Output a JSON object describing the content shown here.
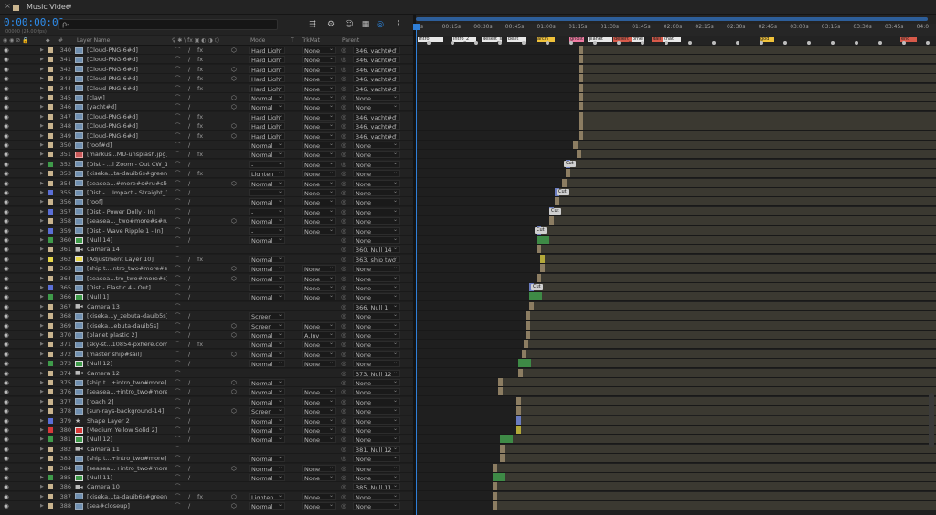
{
  "window": {
    "close_glyph": "×",
    "title": "Music Video",
    "menu_glyph": "≡"
  },
  "toolbar": {
    "timecode": "0:00:00:00",
    "frames": "00000 (24.00 fps)",
    "search_glyph": "ρ-",
    "icons": [
      "comp-flowchart-icon",
      "draft-3d-icon",
      "shy-layers-icon",
      "frame-blending-icon",
      "motion-blur-icon",
      "graph-editor-icon"
    ]
  },
  "columns": {
    "source_icons": "◉ ◉ ⊘ 🔒",
    "label_icon": "◆",
    "num": "#",
    "layer_name": "Layer Name",
    "switches": "♀ ✱ \\ fx ▣ ◐ ◑ ⬡",
    "mode": "Mode",
    "t": "T",
    "trkmat": "TrkMat",
    "parent": "Parent"
  },
  "ruler": {
    "ticks": [
      "0s",
      "00:15s",
      "00:30s",
      "00:45s",
      "01:00s",
      "01:15s",
      "01:30s",
      "01:45s",
      "02:00s",
      "02:15s",
      "02:30s",
      "02:45s",
      "03:00s",
      "03:15s",
      "03:30s",
      "03:45s",
      "04:0"
    ]
  },
  "markers": [
    {
      "text": "Intro",
      "color": "#e8e8e8"
    },
    {
      "text": "intro_2",
      "color": "#e8e8e8"
    },
    {
      "text": "desert_sh",
      "color": "#e8e8e8"
    },
    {
      "text": "beat",
      "color": "#e8e8e8"
    },
    {
      "text": "arch",
      "color": "#f0c23a"
    },
    {
      "text": "ghost",
      "color": "#f07aa2"
    },
    {
      "text": "planet",
      "color": "#e8e8e8"
    },
    {
      "text": "desert_ti",
      "color": "#d85a4a"
    },
    {
      "text": "ome",
      "color": "#e8e8e8"
    },
    {
      "text": "dail",
      "color": "#d85a4a"
    },
    {
      "text": "chat",
      "color": "#e8e8e8"
    },
    {
      "text": "god",
      "color": "#f0c23a"
    },
    {
      "text": "end",
      "color": "#d85a4a"
    }
  ],
  "layers": [
    {
      "num": "340",
      "name": "[Cloud-PNG-6#d]",
      "label": "#c9b48e",
      "type": "footage",
      "fx": true,
      "mode": "Hard Ligh",
      "trkmat": "None",
      "parent": "346. yacht#d"
    },
    {
      "num": "341",
      "name": "[Cloud-PNG-6#d]",
      "label": "#c9b48e",
      "type": "footage",
      "fx": true,
      "mode": "Hard Ligh",
      "trkmat": "None",
      "parent": "346. yacht#d"
    },
    {
      "num": "342",
      "name": "[Cloud-PNG-6#d]",
      "label": "#c9b48e",
      "type": "footage",
      "fx": true,
      "mode": "Hard Ligh",
      "trkmat": "None",
      "parent": "346. yacht#d"
    },
    {
      "num": "343",
      "name": "[Cloud-PNG-6#d]",
      "label": "#c9b48e",
      "type": "footage",
      "fx": true,
      "mode": "Hard Ligh",
      "trkmat": "None",
      "parent": "346. yacht#d"
    },
    {
      "num": "344",
      "name": "[Cloud-PNG-6#d]",
      "label": "#c9b48e",
      "type": "footage",
      "fx": true,
      "mode": "Hard Ligh",
      "trkmat": "None",
      "parent": "346. yacht#d"
    },
    {
      "num": "345",
      "name": "[claw]",
      "label": "#c9b48e",
      "type": "footage",
      "fx": false,
      "mode": "Normal",
      "trkmat": "None",
      "parent": "None"
    },
    {
      "num": "346",
      "name": "[yacht#d]",
      "label": "#c9b48e",
      "type": "footage",
      "fx": false,
      "mode": "Normal",
      "trkmat": "None",
      "parent": "None"
    },
    {
      "num": "347",
      "name": "[Cloud-PNG-6#d]",
      "label": "#c9b48e",
      "type": "footage",
      "fx": true,
      "mode": "Hard Ligh",
      "trkmat": "None",
      "parent": "346. yacht#d"
    },
    {
      "num": "348",
      "name": "[Cloud-PNG-6#d]",
      "label": "#c9b48e",
      "type": "footage",
      "fx": true,
      "mode": "Hard Ligh",
      "trkmat": "None",
      "parent": "346. yacht#d"
    },
    {
      "num": "349",
      "name": "[Cloud-PNG-6#d]",
      "label": "#c9b48e",
      "type": "footage",
      "fx": true,
      "mode": "Hard Ligh",
      "trkmat": "None",
      "parent": "346. yacht#d"
    },
    {
      "num": "350",
      "name": "[roof#d]",
      "label": "#c9b48e",
      "type": "footage",
      "fx": false,
      "mode": "Normal",
      "trkmat": "None",
      "parent": "None"
    },
    {
      "num": "351",
      "name": "[markus...MU-unsplash.jpg]",
      "label": "#c9b48e",
      "type": "image",
      "fx": true,
      "mode": "Normal",
      "trkmat": "None",
      "parent": "None"
    },
    {
      "num": "352",
      "name": "[Dist - ...l Zoom - Out CW_1]",
      "label": "#3f9b4a",
      "type": "precomp",
      "fx": false,
      "mode": "-",
      "trkmat": "None",
      "parent": "None"
    },
    {
      "num": "353",
      "name": "[kiseka...ta-dauib6s#green]",
      "label": "#c9b48e",
      "type": "footage",
      "fx": true,
      "mode": "Lighten",
      "trkmat": "None",
      "parent": "None"
    },
    {
      "num": "354",
      "name": "[seasea...#more#s#ru#slide]",
      "label": "#c9b48e",
      "type": "footage",
      "fx": false,
      "mode": "Normal",
      "trkmat": "None",
      "parent": "None"
    },
    {
      "num": "355",
      "name": "[Dist -... Impact - Straight_1]",
      "label": "#5b6fd6",
      "type": "precomp",
      "fx": false,
      "mode": "-",
      "trkmat": "None",
      "parent": "None"
    },
    {
      "num": "356",
      "name": "[roof]",
      "label": "#c9b48e",
      "type": "footage",
      "fx": false,
      "mode": "Normal",
      "trkmat": "None",
      "parent": "None"
    },
    {
      "num": "357",
      "name": "[Dist - Power Dolly - In]",
      "label": "#5b6fd6",
      "type": "precomp",
      "fx": false,
      "mode": "-",
      "trkmat": "None",
      "parent": "None"
    },
    {
      "num": "358",
      "name": "[seasea..._two#more#s#ru]",
      "label": "#c9b48e",
      "type": "footage",
      "fx": false,
      "mode": "Normal",
      "trkmat": "None",
      "parent": "None"
    },
    {
      "num": "359",
      "name": "[Dist - Wave Ripple 1 - In]",
      "label": "#5b6fd6",
      "type": "precomp",
      "fx": false,
      "mode": "-",
      "trkmat": "None",
      "parent": "None"
    },
    {
      "num": "360",
      "name": "[Null 14]",
      "label": "#3f9b4a",
      "type": "null",
      "fx": false,
      "mode": "Normal",
      "trkmat": "",
      "parent": "None"
    },
    {
      "num": "361",
      "name": "Camera 14",
      "label": "#c9b48e",
      "type": "camera",
      "fx": false,
      "mode": "",
      "trkmat": "",
      "parent": "360. Null 14"
    },
    {
      "num": "362",
      "name": "[Adjustment Layer 10]",
      "label": "#e8d84a",
      "type": "solid",
      "fx": true,
      "mode": "Normal",
      "trkmat": "",
      "parent": "363. ship two"
    },
    {
      "num": "363",
      "name": "[ship t...intro_two#more#s]",
      "label": "#c9b48e",
      "type": "footage",
      "fx": false,
      "mode": "Normal",
      "trkmat": "None",
      "parent": "None"
    },
    {
      "num": "364",
      "name": "[seasea...tro_two#more#s]",
      "label": "#c9b48e",
      "type": "footage",
      "fx": false,
      "mode": "Normal",
      "trkmat": "None",
      "parent": "None"
    },
    {
      "num": "365",
      "name": "[Dist - Elastic 4 - Out]",
      "label": "#5b6fd6",
      "type": "precomp",
      "fx": false,
      "mode": "-",
      "trkmat": "None",
      "parent": "None"
    },
    {
      "num": "366",
      "name": "[Null 1]",
      "label": "#3f9b4a",
      "type": "null",
      "fx": false,
      "mode": "Normal",
      "trkmat": "None",
      "parent": "None"
    },
    {
      "num": "367",
      "name": "Camera 13",
      "label": "#c9b48e",
      "type": "camera",
      "fx": false,
      "mode": "",
      "trkmat": "",
      "parent": "366. Null 1"
    },
    {
      "num": "368",
      "name": "[kiseka...y_zebuta-dauib5s]",
      "label": "#c9b48e",
      "type": "footage",
      "fx": false,
      "mode": "Screen",
      "trkmat": "",
      "parent": "None"
    },
    {
      "num": "369",
      "name": "[kiseka...ebuta-dauib5s]",
      "label": "#c9b48e",
      "type": "footage",
      "fx": false,
      "mode": "Screen",
      "trkmat": "None",
      "parent": "None"
    },
    {
      "num": "370",
      "name": "[planet plastic 2]",
      "label": "#c9b48e",
      "type": "footage",
      "fx": false,
      "mode": "Normal",
      "trkmat": "A.Inv",
      "parent": "None"
    },
    {
      "num": "371",
      "name": "[sky-st...10854-pxhere.com]",
      "label": "#c9b48e",
      "type": "footage",
      "fx": true,
      "mode": "Normal",
      "trkmat": "None",
      "parent": "None"
    },
    {
      "num": "372",
      "name": "[master ship#sail]",
      "label": "#c9b48e",
      "type": "footage",
      "fx": false,
      "mode": "Normal",
      "trkmat": "None",
      "parent": "None"
    },
    {
      "num": "373",
      "name": "[Null 12]",
      "label": "#3f9b4a",
      "type": "null",
      "fx": false,
      "mode": "Normal",
      "trkmat": "None",
      "parent": "None"
    },
    {
      "num": "374",
      "name": "Camera 12",
      "label": "#c9b48e",
      "type": "camera",
      "fx": false,
      "mode": "",
      "trkmat": "",
      "parent": "373. Null 12"
    },
    {
      "num": "375",
      "name": "[ship t...+intro_two#more]",
      "label": "#c9b48e",
      "type": "footage",
      "fx": false,
      "mode": "Normal",
      "trkmat": "",
      "parent": "None"
    },
    {
      "num": "376",
      "name": "[seasea...+intro_two#more]",
      "label": "#c9b48e",
      "type": "footage",
      "fx": false,
      "mode": "Normal",
      "trkmat": "None",
      "parent": "None"
    },
    {
      "num": "377",
      "name": "[roach 2]",
      "label": "#c9b48e",
      "type": "footage",
      "fx": false,
      "mode": "Normal",
      "trkmat": "None",
      "parent": "None"
    },
    {
      "num": "378",
      "name": "[sun-rays-background-14]",
      "label": "#c9b48e",
      "type": "footage",
      "fx": false,
      "mode": "Screen",
      "trkmat": "None",
      "parent": "None"
    },
    {
      "num": "379",
      "name": "Shape Layer 2",
      "label": "#5b6fd6",
      "type": "shape",
      "fx": false,
      "mode": "Normal",
      "trkmat": "None",
      "parent": "None"
    },
    {
      "num": "380",
      "name": "[Medium Yellow Solid 2]",
      "label": "#d83a3a",
      "type": "solid",
      "fx": false,
      "mode": "Normal",
      "trkmat": "None",
      "parent": "None"
    },
    {
      "num": "381",
      "name": "[Null 12]",
      "label": "#3f9b4a",
      "type": "null",
      "fx": false,
      "mode": "Normal",
      "trkmat": "None",
      "parent": "None"
    },
    {
      "num": "382",
      "name": "Camera 11",
      "label": "#c9b48e",
      "type": "camera",
      "fx": false,
      "mode": "",
      "trkmat": "",
      "parent": "381. Null 12"
    },
    {
      "num": "383",
      "name": "[ship t...+intro_two#more]",
      "label": "#c9b48e",
      "type": "footage",
      "fx": false,
      "mode": "Normal",
      "trkmat": "",
      "parent": "None"
    },
    {
      "num": "384",
      "name": "[seasea...+intro_two#more]",
      "label": "#c9b48e",
      "type": "footage",
      "fx": false,
      "mode": "Normal",
      "trkmat": "None",
      "parent": "None"
    },
    {
      "num": "385",
      "name": "[Null 11]",
      "label": "#3f9b4a",
      "type": "null",
      "fx": false,
      "mode": "Normal",
      "trkmat": "None",
      "parent": "None"
    },
    {
      "num": "386",
      "name": "Camera 10",
      "label": "#c9b48e",
      "type": "camera",
      "fx": false,
      "mode": "",
      "trkmat": "",
      "parent": "385. Null 11"
    },
    {
      "num": "387",
      "name": "[kiseka...ta-dauib6s#green]",
      "label": "#c9b48e",
      "type": "footage",
      "fx": true,
      "mode": "Lighten",
      "trkmat": "None",
      "parent": "None"
    },
    {
      "num": "388",
      "name": "[sea#closeup]",
      "label": "#c9b48e",
      "type": "footage",
      "fx": false,
      "mode": "Normal",
      "trkmat": "None",
      "parent": "None"
    }
  ],
  "cut_labels": [
    "Cut",
    "Cut",
    "Cut",
    "Cut",
    "Cut",
    "Cut"
  ]
}
